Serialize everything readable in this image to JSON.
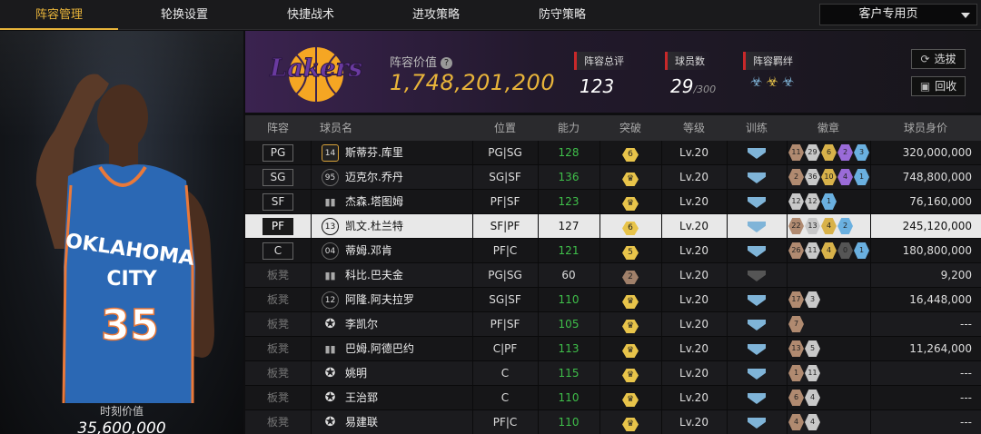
{
  "nav": {
    "tabs": [
      {
        "label": "阵容管理",
        "active": true
      },
      {
        "label": "轮换设置"
      },
      {
        "label": "快捷战术"
      },
      {
        "label": "进攻策略"
      },
      {
        "label": "防守策略"
      }
    ],
    "dropdown_label": "客户专用页"
  },
  "player_card": {
    "jersey_team": "OKLAHOMA CITY",
    "jersey_number": "35",
    "moment_label": "时刻价值",
    "moment_value": "35,600,000"
  },
  "header": {
    "team_logo": "LOS ANGELES LAKERS",
    "value_label": "阵容价值",
    "value": "1,748,201,200",
    "overall_label": "阵容总评",
    "overall": "123",
    "players_label": "球员数",
    "players": "29",
    "players_max": "/300",
    "bond_label": "阵容羁绊",
    "bond_icons": [
      "team-bond-icon",
      "team-bond-icon",
      "team-bond-icon"
    ],
    "select_label": "选拔",
    "recycle_label": "回收"
  },
  "table": {
    "columns": [
      "阵容",
      "球员名",
      "位置",
      "能力",
      "突破",
      "等级",
      "训练",
      "徽章",
      "球员身价"
    ],
    "rows": [
      {
        "slot": "PG",
        "jersey": "14",
        "name": "斯蒂芬.库里",
        "pos": "PG|SG",
        "ability": "128",
        "green": true,
        "brk": "6",
        "brk_color": "gold",
        "level": "Lv.20",
        "train": true,
        "badges": [
          [
            "11",
            "bronze"
          ],
          [
            "29",
            "silver"
          ],
          [
            "6",
            "gold"
          ],
          [
            "2",
            "purple"
          ],
          [
            "3",
            "blue"
          ]
        ],
        "value": "320,000,000"
      },
      {
        "slot": "SG",
        "jersey": "95",
        "name": "迈克尔.乔丹",
        "pos": "SG|SF",
        "ability": "136",
        "green": true,
        "brk": "♛",
        "brk_color": "gold",
        "level": "Lv.20",
        "train": true,
        "badges": [
          [
            "2",
            "bronze"
          ],
          [
            "36",
            "silver"
          ],
          [
            "10",
            "gold"
          ],
          [
            "4",
            "purple"
          ],
          [
            "1",
            "blue"
          ]
        ],
        "value": "748,800,000"
      },
      {
        "slot": "SF",
        "jersey": "",
        "name": "杰森.塔图姆",
        "pos": "PF|SF",
        "ability": "123",
        "green": true,
        "brk": "♛",
        "brk_color": "gold",
        "level": "Lv.20",
        "train": true,
        "badges": [
          [
            "12",
            "silver"
          ],
          [
            "12",
            "silver"
          ],
          [
            "1",
            "blue"
          ]
        ],
        "value": "76,160,000"
      },
      {
        "slot": "PF",
        "jersey": "13",
        "name": "凯文.杜兰特",
        "pos": "SF|PF",
        "ability": "127",
        "green": false,
        "brk": "6",
        "brk_color": "gold",
        "level": "Lv.20",
        "train": true,
        "badges": [
          [
            "22",
            "bronze"
          ],
          [
            "13",
            "silver"
          ],
          [
            "4",
            "gold"
          ],
          [
            "2",
            "blue"
          ]
        ],
        "value": "245,120,000"
      },
      {
        "slot": "C",
        "jersey": "04",
        "name": "蒂姆.邓肯",
        "pos": "PF|C",
        "ability": "121",
        "green": true,
        "brk": "5",
        "brk_color": "gold",
        "level": "Lv.20",
        "train": true,
        "badges": [
          [
            "26",
            "bronze"
          ],
          [
            "11",
            "silver"
          ],
          [
            "4",
            "gold"
          ],
          [
            "0",
            "dark"
          ],
          [
            "1",
            "blue"
          ]
        ],
        "value": "180,800,000"
      },
      {
        "slot": "板凳",
        "jersey": "",
        "name": "科比.巴夫金",
        "pos": "PG|SG",
        "ability": "60",
        "green": false,
        "brk": "2",
        "brk_color": "bronze",
        "level": "Lv.20",
        "train": false,
        "badges": [],
        "value": "9,200"
      },
      {
        "slot": "板凳",
        "jersey": "12",
        "name": "阿隆.阿夫拉罗",
        "pos": "SG|SF",
        "ability": "110",
        "green": true,
        "brk": "♛",
        "brk_color": "gold",
        "level": "Lv.20",
        "train": true,
        "badges": [
          [
            "17",
            "bronze"
          ],
          [
            "3",
            "silver"
          ]
        ],
        "value": "16,448,000"
      },
      {
        "slot": "板凳",
        "jersey": "",
        "name": "李凯尔",
        "pos": "PF|SF",
        "ability": "105",
        "green": true,
        "brk": "♛",
        "brk_color": "gold",
        "level": "Lv.20",
        "train": true,
        "badges": [
          [
            "7",
            "bronze"
          ]
        ],
        "value": "---"
      },
      {
        "slot": "板凳",
        "jersey": "",
        "name": "巴姆.阿德巴约",
        "pos": "C|PF",
        "ability": "113",
        "green": true,
        "brk": "♛",
        "brk_color": "gold",
        "level": "Lv.20",
        "train": true,
        "badges": [
          [
            "13",
            "bronze"
          ],
          [
            "5",
            "silver"
          ]
        ],
        "value": "11,264,000"
      },
      {
        "slot": "板凳",
        "jersey": "",
        "name": "姚明",
        "pos": "C",
        "ability": "115",
        "green": true,
        "brk": "♛",
        "brk_color": "gold",
        "level": "Lv.20",
        "train": true,
        "badges": [
          [
            "1",
            "bronze"
          ],
          [
            "11",
            "silver"
          ]
        ],
        "value": "---"
      },
      {
        "slot": "板凳",
        "jersey": "",
        "name": "王治郅",
        "pos": "C",
        "ability": "110",
        "green": true,
        "brk": "♛",
        "brk_color": "gold",
        "level": "Lv.20",
        "train": true,
        "badges": [
          [
            "6",
            "bronze"
          ],
          [
            "4",
            "silver"
          ]
        ],
        "value": "---"
      },
      {
        "slot": "板凳",
        "jersey": "",
        "name": "易建联",
        "pos": "PF|C",
        "ability": "110",
        "green": true,
        "brk": "♛",
        "brk_color": "gold",
        "level": "Lv.20",
        "train": true,
        "badges": [
          [
            "4",
            "bronze"
          ],
          [
            "4",
            "silver"
          ]
        ],
        "value": "---"
      }
    ]
  }
}
